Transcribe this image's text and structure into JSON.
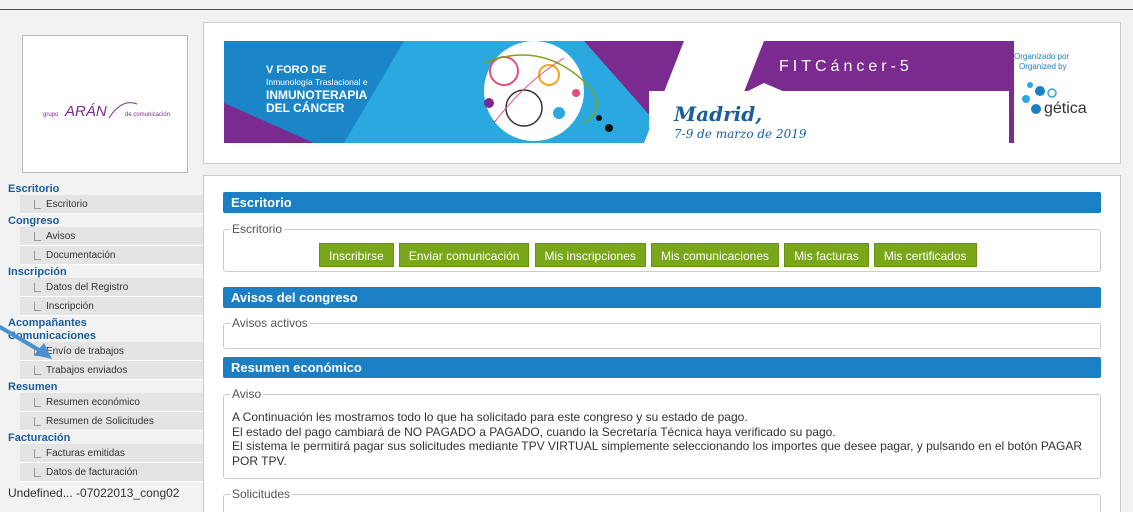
{
  "logo": {
    "left": "grupo",
    "brand": "ARÁN",
    "right": "de comunicación"
  },
  "banner": {
    "foro_line1": "V FORO DE",
    "foro_line2": "Inmunología Traslacional e",
    "foro_line3": "INMUNOTERAPIA",
    "foro_line4": "DEL CÁNCER",
    "city": "Madrid,",
    "dates": "7-9 de marzo de 2019",
    "event_code": "FITCáncer-5",
    "organized_es": "Organizado por",
    "organized_en": "Organized by",
    "org_name": "gética"
  },
  "sidebar": {
    "sections": [
      {
        "title": "Escritorio",
        "items": [
          "Escritorio"
        ]
      },
      {
        "title": "Congreso",
        "items": [
          "Avisos",
          "Documentación"
        ]
      },
      {
        "title": "Inscripción",
        "items": [
          "Datos del Registro",
          "Inscripción"
        ]
      },
      {
        "title": "Acompañantes",
        "items": []
      },
      {
        "title": "Comunicaciones",
        "items": [
          "Envío de trabajos",
          "Trabajos enviados"
        ]
      },
      {
        "title": "Resumen",
        "items": [
          "Resumen económico",
          "Resumen de Solicitudes"
        ]
      },
      {
        "title": "Facturación",
        "items": [
          "Facturas emitidas",
          "Datos de facturación"
        ]
      }
    ],
    "footer": "Undefined... -07022013_cong02"
  },
  "main": {
    "escritorio_header": "Escritorio",
    "escritorio_legend": "Escritorio",
    "buttons": [
      "Inscribirse",
      "Enviar comunicación",
      "Mis inscripciones",
      "Mis comunicaciones",
      "Mis facturas",
      "Mis certificados"
    ],
    "avisos_header": "Avisos del congreso",
    "avisos_legend": "Avisos activos",
    "resumen_header": "Resumen económico",
    "aviso_legend": "Aviso",
    "aviso_lines": [
      "A Continuación les mostramos todo lo que ha solicitado para este congreso y su estado de pago.",
      "El estado del pago cambiará de NO PAGADO a PAGADO, cuando la Secretaría Técnica haya verificado su pago.",
      "El sistema le permitirá pagar sus solicitudes mediante TPV VIRTUAL simplemente seleccionando los importes que desee pagar, y pulsando en el botón PAGAR",
      "POR TPV."
    ],
    "solicitudes_legend": "Solicitudes"
  },
  "colors": {
    "header_blue": "#1a7fc5",
    "button_green": "#7aa61a",
    "sidebar_link": "#1a5e9e",
    "banner_purple": "#7b2b8f",
    "banner_cyan": "#29a9e0"
  }
}
